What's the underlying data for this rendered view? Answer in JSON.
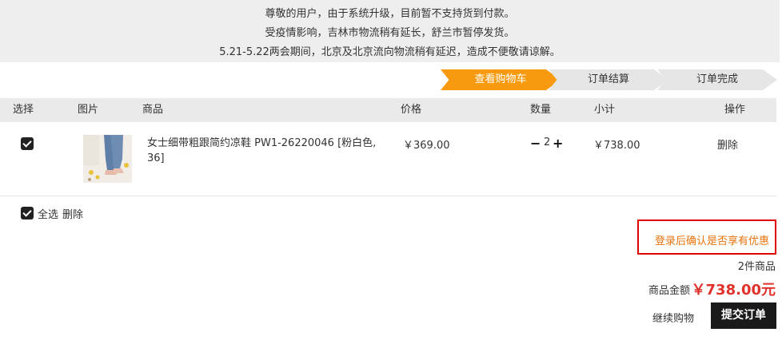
{
  "notice": {
    "lines": [
      "尊敬的用户，由于系统升级，目前暂不支持货到付款。",
      "受疫情影响，吉林市物流稍有延长，舒兰市暂停发货。",
      "5.21-5.22两会期间，北京及北京流向物流稍有延迟，造成不便敬请谅解。"
    ]
  },
  "steps": [
    {
      "label": "查看购物车",
      "active": true
    },
    {
      "label": "订单结算",
      "active": false
    },
    {
      "label": "订单完成",
      "active": false
    }
  ],
  "table": {
    "headers": {
      "select": "选择",
      "image": "图片",
      "product": "商品",
      "price": "价格",
      "quantity": "数量",
      "subtotal": "小计",
      "action": "操作"
    }
  },
  "items": [
    {
      "checked": true,
      "name": "女士细带粗跟简约凉鞋 PW1-26220046 [粉白色, 36]",
      "price": "￥369.00",
      "quantity": "2",
      "subtotal": "￥738.00",
      "delete_label": "删除"
    }
  ],
  "footer": {
    "select_all_label": "全选",
    "delete_label": "删除",
    "promo_text": "登录后确认是否享有优惠",
    "count_text": "2件商品",
    "amount_label": "商品金额",
    "amount_value": "￥738.00元",
    "continue_label": "继续购物",
    "submit_label": "提交订单"
  },
  "colors": {
    "accent": "#f79a0f",
    "price_red": "#e0322b",
    "promo_orange": "#e8730c",
    "submit_bg": "#1a1a1a"
  }
}
